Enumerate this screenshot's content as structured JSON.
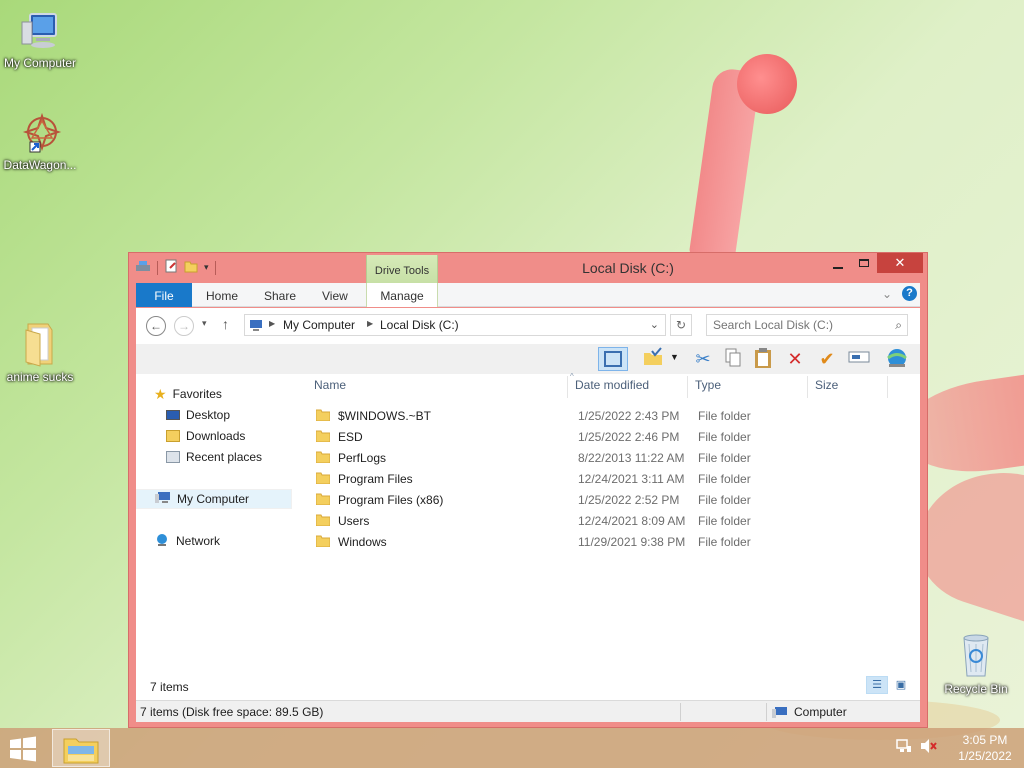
{
  "desktop": {
    "icons": [
      {
        "label": "My Computer"
      },
      {
        "label": "DataWagon..."
      },
      {
        "label": "anime sucks"
      },
      {
        "label": "Recycle Bin"
      }
    ]
  },
  "window": {
    "title": "Local Disk (C:)",
    "context_tab": "Drive Tools",
    "ribbon_tabs": [
      "File",
      "Home",
      "Share",
      "View",
      "Manage"
    ],
    "address": {
      "crumbs": [
        "My Computer",
        "Local Disk (C:)"
      ]
    },
    "search": {
      "placeholder": "Search Local Disk (C:)"
    },
    "nav_pane": {
      "favorites": "Favorites",
      "favorites_items": [
        "Desktop",
        "Downloads",
        "Recent places"
      ],
      "computer": "My Computer",
      "network": "Network"
    },
    "columns": [
      "Name",
      "Date modified",
      "Type",
      "Size"
    ],
    "files": [
      {
        "name": "$WINDOWS.~BT",
        "date": "1/25/2022 2:43 PM",
        "type": "File folder"
      },
      {
        "name": "ESD",
        "date": "1/25/2022 2:46 PM",
        "type": "File folder"
      },
      {
        "name": "PerfLogs",
        "date": "8/22/2013 11:22 AM",
        "type": "File folder"
      },
      {
        "name": "Program Files",
        "date": "12/24/2021 3:11 AM",
        "type": "File folder"
      },
      {
        "name": "Program Files (x86)",
        "date": "1/25/2022 2:52 PM",
        "type": "File folder"
      },
      {
        "name": "Users",
        "date": "12/24/2021 8:09 AM",
        "type": "File folder"
      },
      {
        "name": "Windows",
        "date": "11/29/2021 9:38 PM",
        "type": "File folder"
      }
    ],
    "item_count": "7 items",
    "status_left": "7 items (Disk free space: 89.5 GB)",
    "status_right": "Computer"
  },
  "taskbar": {
    "time": "3:05 PM",
    "date": "1/25/2022"
  },
  "colors": {
    "window_frame": "#f08d89",
    "file_tab": "#1979ca",
    "close_button": "#c7433e"
  }
}
